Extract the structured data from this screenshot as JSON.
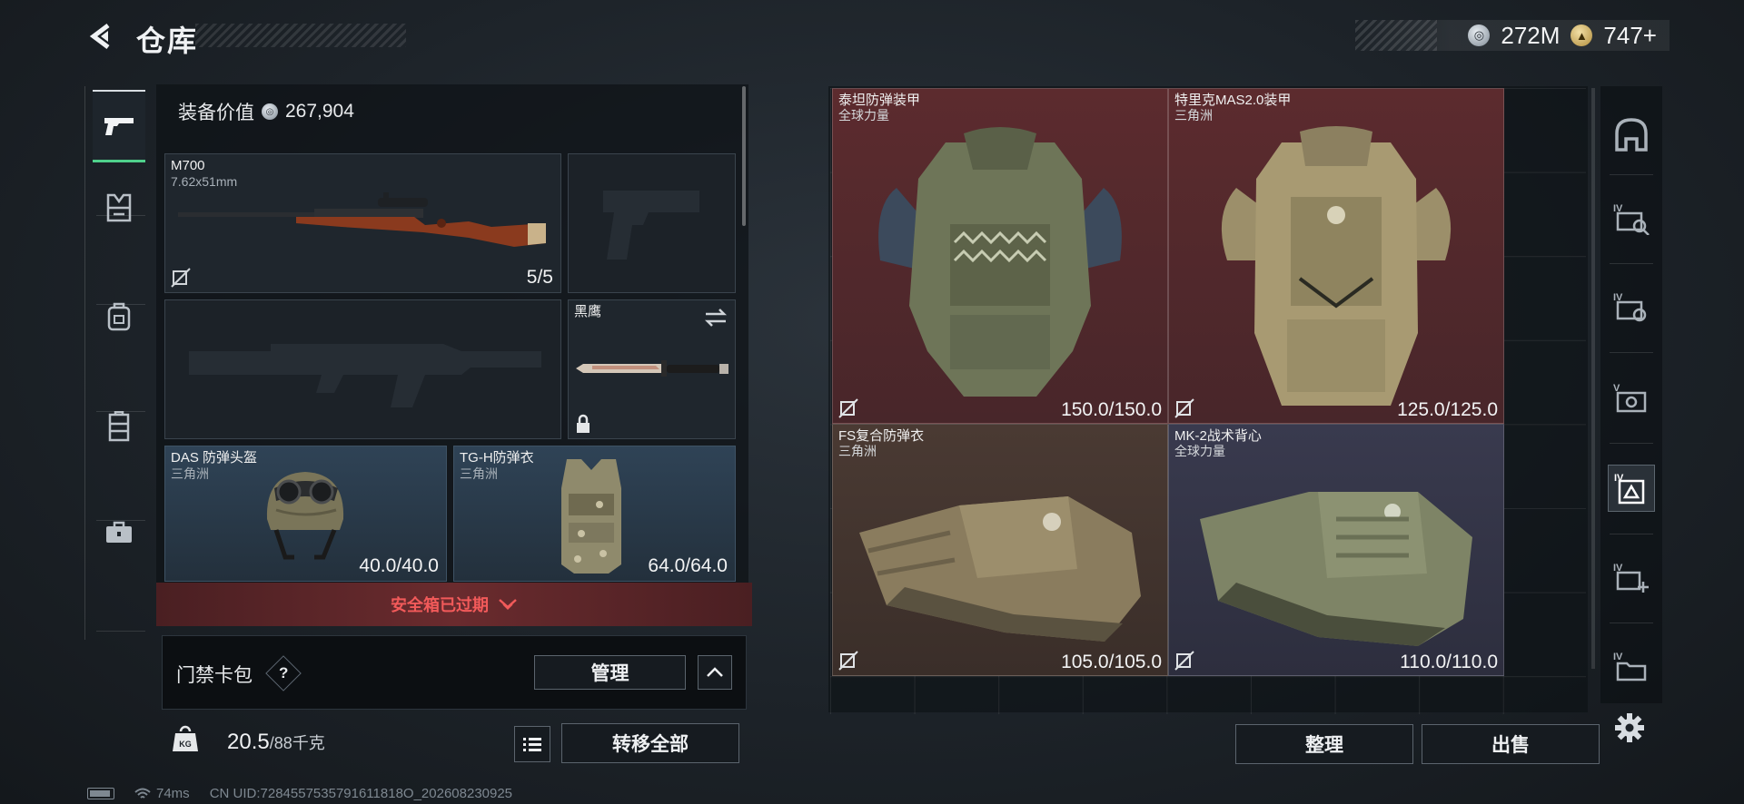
{
  "header": {
    "title": "仓库",
    "currency": [
      {
        "icon": "silver-coin-icon",
        "value": "272M"
      },
      {
        "icon": "gold-coin-icon",
        "value": "747+"
      }
    ]
  },
  "left_rail": {
    "items": [
      {
        "name": "weapons",
        "icon": "pistol-icon",
        "active": true
      },
      {
        "name": "armor",
        "icon": "armor-icon",
        "active": false
      },
      {
        "name": "backpack",
        "icon": "backpack-icon",
        "active": false
      },
      {
        "name": "vest",
        "icon": "vest-icon",
        "active": false
      },
      {
        "name": "case",
        "icon": "briefcase-icon",
        "active": false
      }
    ]
  },
  "equipment": {
    "value_label": "装备价值",
    "value": "267,904",
    "slots": {
      "primary": {
        "name": "M700",
        "caliber": "7.62x51mm",
        "ammo": "5/5"
      },
      "knife": {
        "name": "黑鹰"
      },
      "helmet": {
        "name": "DAS 防弹头盔",
        "source": "三角洲",
        "durability": "40.0/40.0"
      },
      "armor": {
        "name": "TG-H防弹衣",
        "source": "三角洲",
        "durability": "64.0/64.0"
      }
    },
    "safebox_status": "安全箱已过期"
  },
  "card_pack": {
    "label": "门禁卡包",
    "help": "?",
    "manage_label": "管理"
  },
  "bottom_bar": {
    "weight_current": "20.5",
    "weight_max": "/88千克",
    "transfer_label": "转移全部"
  },
  "stash": {
    "items": [
      {
        "name": "泰坦防弹装甲",
        "source": "全球力量",
        "durability": "150.0/150.0",
        "rarity_color": "#5c2b2e"
      },
      {
        "name": "特里克MAS2.0装甲",
        "source": "三角洲",
        "durability": "125.0/125.0",
        "rarity_color": "#5c2b2e"
      },
      {
        "name": "FS复合防弹衣",
        "source": "三角洲",
        "durability": "105.0/105.0",
        "rarity_color": "#4a3a33"
      },
      {
        "name": "MK-2战术背心",
        "source": "全球力量",
        "durability": "110.0/110.0",
        "rarity_color": "#393a4e"
      }
    ],
    "sort_label": "整理",
    "sell_label": "出售"
  },
  "right_rail": {
    "items": [
      "helmet-filter-icon",
      "tier4-filter-icon",
      "tier4-filter-icon",
      "tier5-filter-icon",
      "tier4-armor-filter-icon",
      "tier4-add-filter-icon",
      "tier4-folder-filter-icon"
    ],
    "settings_icon": "gear-icon"
  },
  "footer": {
    "ping": "74ms",
    "uid": "CN UID:7284557535791611818O_202608230925"
  }
}
